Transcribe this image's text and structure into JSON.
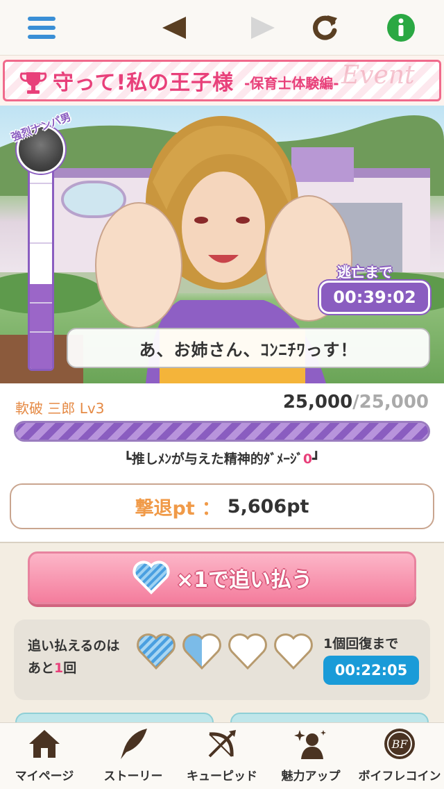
{
  "toolbar": {
    "menu_icon": "hamburger-icon",
    "back_icon": "triangle-left-icon",
    "forward_icon": "triangle-right-icon",
    "reload_icon": "reload-icon",
    "info_icon": "info-icon"
  },
  "event": {
    "title": "守って!私の王子様",
    "subtitle": "-保育士体験編-",
    "watermark": "Event"
  },
  "battle": {
    "enemy_tag": "強烈ナンパ男",
    "escape_label": "逃亡まで",
    "escape_timer": "00:39:02",
    "speech": "あ、お姉さん、ｺﾝﾆﾁﾜっす！",
    "gauge_level": 0.38
  },
  "status": {
    "char_name": "軟破 三郎 Lv3",
    "hp_current": "25,000",
    "hp_max": "/25,000",
    "hp_fraction": 1.0,
    "damage_prefix": "┗推しﾒﾝが与えた精神的ﾀﾞﾒｰｼﾞ",
    "damage_value": "0",
    "damage_suffix": "┛",
    "pt_label": "撃退pt",
    "pt_sep": "：",
    "pt_value": "5,606pt"
  },
  "action": {
    "chase_label": "×1で追い払う"
  },
  "stamina": {
    "line1": "追い払えるのは",
    "line2_pre": "あと",
    "line2_num": "1",
    "line2_post": "回",
    "hearts_full": 1,
    "hearts_half": 1,
    "hearts_total": 4,
    "recover_label": "1個回復まで",
    "recover_timer": "00:22:05"
  },
  "nav": {
    "items": [
      {
        "label": "マイページ",
        "icon": "home-icon"
      },
      {
        "label": "ストーリー",
        "icon": "quill-icon"
      },
      {
        "label": "キューピッド",
        "icon": "bow-arrow-icon"
      },
      {
        "label": "魅力アップ",
        "icon": "person-sparkle-icon"
      },
      {
        "label": "ボイフレコイン",
        "icon": "bf-coin-icon"
      }
    ]
  },
  "colors": {
    "accent_pink": "#e8407a",
    "accent_purple": "#8a5dc0",
    "accent_orange": "#f09a48",
    "timer_blue": "#1a9bd8",
    "info_green": "#2aa843"
  }
}
